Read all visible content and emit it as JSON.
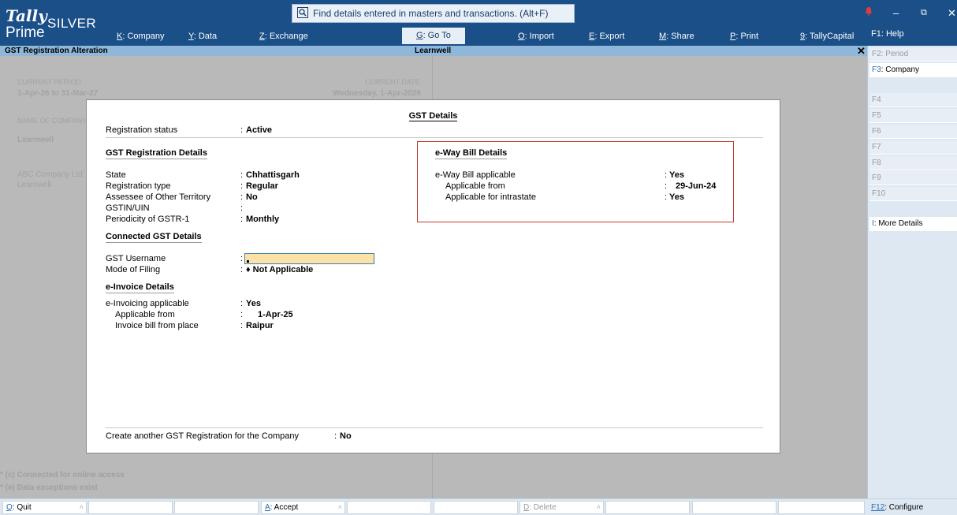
{
  "app": {
    "logo_tally": "Tally",
    "logo_edition": "SILVER",
    "logo_prime": "Prime",
    "search_placeholder": "Find details entered in masters and transactions. (Alt+F)"
  },
  "menu": [
    {
      "key": "K",
      "label": ": Company"
    },
    {
      "key": "Y",
      "label": ": Data"
    },
    {
      "key": "Z",
      "label": ": Exchange"
    },
    {
      "key": "G",
      "label": ": Go To"
    },
    {
      "key": "O",
      "label": ": Import"
    },
    {
      "key": "E",
      "label": ": Export"
    },
    {
      "key": "M",
      "label": ": Share"
    },
    {
      "key": "P",
      "label": ": Print"
    },
    {
      "key": "9",
      "label": ": TallyCapital"
    }
  ],
  "help": "F1: Help",
  "window_controls": {
    "minimize": "–",
    "restore": "⧉",
    "close": "✕"
  },
  "titlebar": {
    "left": "GST Registration Alteration",
    "center": "Learnwell",
    "close": "✕"
  },
  "background": {
    "current_period_label": "CURRENT PERIOD",
    "current_period_value": "1-Apr-26 to 31-Mar-27",
    "current_date_label": "CURRENT DATE",
    "current_date_value": "Wednesday, 1-Apr-2026",
    "name_of_company_label": "NAME OF COMPANY",
    "company_name": "Learnwell",
    "company_list": [
      "ABC Company Ltd",
      "Learnwell"
    ],
    "footnotes": [
      "* (c) Connected for online access",
      "* (e) Data exceptions exist"
    ]
  },
  "right_panel": [
    {
      "key": "F2",
      "label": ": Period",
      "state": "dim"
    },
    {
      "key": "F3",
      "label": ": Company",
      "state": "on"
    },
    {
      "key": "F4",
      "label": "",
      "state": "dim"
    },
    {
      "key": "F5",
      "label": "",
      "state": "dim"
    },
    {
      "key": "F6",
      "label": "",
      "state": "dim"
    },
    {
      "key": "F7",
      "label": "",
      "state": "dim"
    },
    {
      "key": "F8",
      "label": "",
      "state": "dim"
    },
    {
      "key": "F9",
      "label": "",
      "state": "dim"
    },
    {
      "key": "F10",
      "label": "",
      "state": "dim"
    },
    {
      "key": "I",
      "label": ": More Details",
      "state": "on"
    },
    {
      "key": "F12",
      "label": ": Configure",
      "state": "on"
    }
  ],
  "bottom_bar": [
    {
      "key": "Q",
      "label": ": Quit",
      "state": "on"
    },
    {
      "key": "A",
      "label": ": Accept",
      "state": "on"
    },
    {
      "key": "D",
      "label": ": Delete",
      "state": "dim"
    }
  ],
  "dialog": {
    "title": "GST Details",
    "registration_status": {
      "label": "Registration status",
      "value": "Active"
    },
    "gst_reg_section": "GST Registration Details",
    "state": {
      "label": "State",
      "value": "Chhattisgarh"
    },
    "registration_type": {
      "label": "Registration type",
      "value": "Regular"
    },
    "assessee_other_territory": {
      "label": "Assessee of Other Territory",
      "value": "No"
    },
    "gstin": {
      "label": "GSTIN/UIN",
      "value": ""
    },
    "periodicity": {
      "label": "Periodicity of GSTR-1",
      "value": "Monthly"
    },
    "connected_section": "Connected GST Details",
    "gst_username": {
      "label": "GST Username",
      "value": ""
    },
    "mode_of_filing": {
      "label": "Mode of Filing",
      "value": "♦ Not Applicable"
    },
    "einvoice_section": "e-Invoice Details",
    "einvoicing_applicable": {
      "label": "e-Invoicing applicable",
      "value": "Yes"
    },
    "einvoice_applicable_from": {
      "label": "Applicable from",
      "value": "1-Apr-25"
    },
    "invoice_bill_from_place": {
      "label": "Invoice bill from place",
      "value": "Raipur"
    },
    "ewaybill_section": "e-Way Bill Details",
    "ewaybill_applicable": {
      "label": "e-Way Bill applicable",
      "value": "Yes"
    },
    "ewaybill_applicable_from": {
      "label": "Applicable from",
      "value": "29-Jun-24"
    },
    "ewaybill_intrastate": {
      "label": "Applicable for intrastate",
      "value": "Yes"
    },
    "create_another": {
      "label": "Create another GST Registration for the Company",
      "value": "No"
    }
  }
}
